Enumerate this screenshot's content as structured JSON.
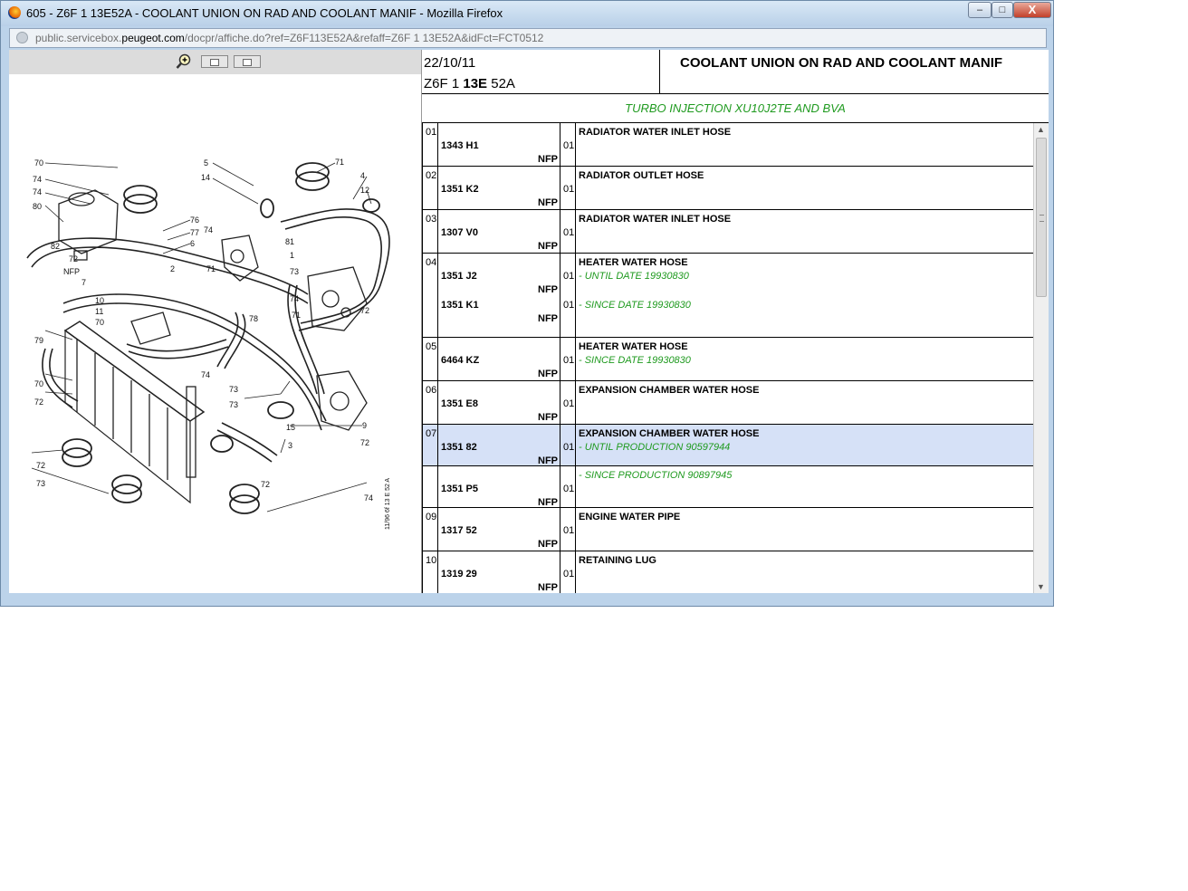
{
  "window": {
    "title": "605 - Z6F 1 13E52A - COOLANT UNION ON RAD AND COOLANT MANIF - Mozilla Firefox",
    "url_prefix": "public.servicebox.",
    "url_domain": "peugeot.com",
    "url_path": "/docpr/affiche.do?ref=Z6F113E52A&refaff=Z6F 1 13E52A&idFct=FCT0512",
    "controls": {
      "minimize": "–",
      "maximize": "□",
      "close": "X"
    }
  },
  "toolbar": {
    "icons": [
      "zoom-in-icon",
      "prev-page-icon",
      "next-page-icon"
    ]
  },
  "diagram": {
    "code": "11/96 6f  13 E 52 A"
  },
  "header": {
    "date": "22/10/11",
    "ref_a": "Z6F 1 ",
    "ref_b": "13E",
    "ref_c": " 52A",
    "title": "COOLANT UNION ON RAD AND COOLANT MANIF",
    "subtitle": "TURBO INJECTION XU10J2TE AND BVA"
  },
  "parts": [
    {
      "num": "01",
      "part": "1343 H1",
      "nfp": "NFP",
      "qty": "01",
      "desc": "RADIATOR WATER INLET HOSE"
    },
    {
      "num": "02",
      "part": "1351 K2",
      "nfp": "NFP",
      "qty": "01",
      "desc": "RADIATOR OUTLET HOSE"
    },
    {
      "num": "03",
      "part": "1307 V0",
      "nfp": "NFP",
      "qty": "01",
      "desc": "RADIATOR WATER INLET HOSE"
    },
    {
      "num": "04",
      "part": "1351 J2",
      "nfp": "NFP",
      "qty": "01",
      "desc": "HEATER WATER HOSE",
      "note": "- UNTIL DATE 19930830",
      "part2": "1351 K1",
      "nfp2": "NFP",
      "qty2": "01",
      "note2": "- SINCE DATE 19930830"
    },
    {
      "num": "05",
      "part": "6464 KZ",
      "nfp": "NFP",
      "qty": "01",
      "desc": "HEATER WATER HOSE",
      "note": "- SINCE DATE 19930830"
    },
    {
      "num": "06",
      "part": "1351 E8",
      "nfp": "NFP",
      "qty": "01",
      "desc": "EXPANSION CHAMBER WATER HOSE"
    },
    {
      "num": "07",
      "part": "1351 82",
      "nfp": "NFP",
      "qty": "01",
      "desc": "EXPANSION CHAMBER WATER HOSE",
      "note": "- UNTIL PRODUCTION 90597944",
      "highlighted": true
    },
    {
      "num": "",
      "part": "1351 P5",
      "nfp": "NFP",
      "qty": "01",
      "note": "- SINCE PRODUCTION 90897945"
    },
    {
      "num": "09",
      "part": "1317 52",
      "nfp": "NFP",
      "qty": "01",
      "desc": "ENGINE WATER PIPE"
    },
    {
      "num": "10",
      "part": "1319 29",
      "nfp": "NFP",
      "qty": "01",
      "desc": "RETAINING LUG"
    }
  ],
  "colors": {
    "note_green": "#1f9a1f",
    "highlight": "#d6e1f7",
    "titlebar": "#bcd3ea"
  }
}
